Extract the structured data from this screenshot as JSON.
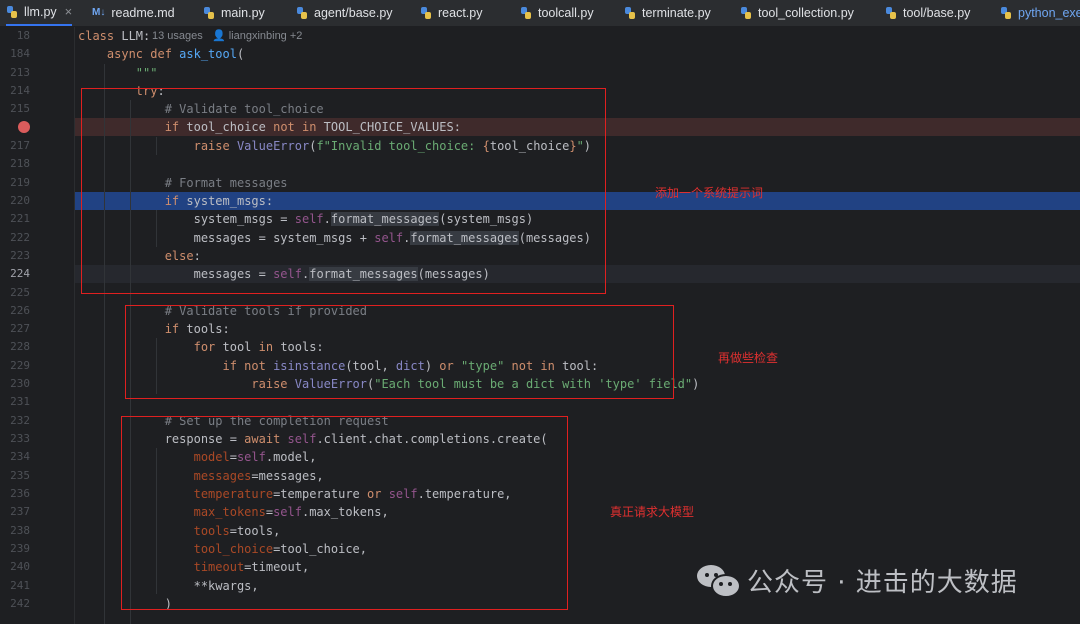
{
  "tabs": [
    {
      "label": "llm.py",
      "icon": "python-file-icon",
      "active": true,
      "closable": true
    },
    {
      "label": "readme.md",
      "icon": "markdown-file-icon",
      "prefix": "M↓"
    },
    {
      "label": "main.py",
      "icon": "python-file-icon"
    },
    {
      "label": "agent/base.py",
      "icon": "python-file-icon"
    },
    {
      "label": "react.py",
      "icon": "python-file-icon"
    },
    {
      "label": "toolcall.py",
      "icon": "python-file-icon"
    },
    {
      "label": "terminate.py",
      "icon": "python-file-icon"
    },
    {
      "label": "tool_collection.py",
      "icon": "python-file-icon"
    },
    {
      "label": "tool/base.py",
      "icon": "python-file-icon"
    },
    {
      "label": "python_exec",
      "icon": "python-file-icon"
    }
  ],
  "tab_close_glyph": "×",
  "editor": {
    "inlay_usages": "13 usages",
    "inlay_author": "liangxinbing +2",
    "breakpoint_color": "#db5c5c",
    "line_numbers": [
      "18",
      "184",
      "213",
      "214",
      "215",
      "216",
      "217",
      "218",
      "219",
      "220",
      "221",
      "222",
      "223",
      "224",
      "225",
      "226",
      "227",
      "228",
      "229",
      "230",
      "231",
      "232",
      "233",
      "234",
      "235",
      "236",
      "237",
      "238",
      "239",
      "240",
      "241",
      "242"
    ]
  },
  "annotations": {
    "box1_label": "添加一个系统提示词",
    "box2_label": "再做些检查",
    "box3_label": "真正请求大模型",
    "color": "#e02020"
  },
  "watermark": {
    "text": "公众号 · 进击的大数据",
    "icon": "wechat-icon"
  }
}
